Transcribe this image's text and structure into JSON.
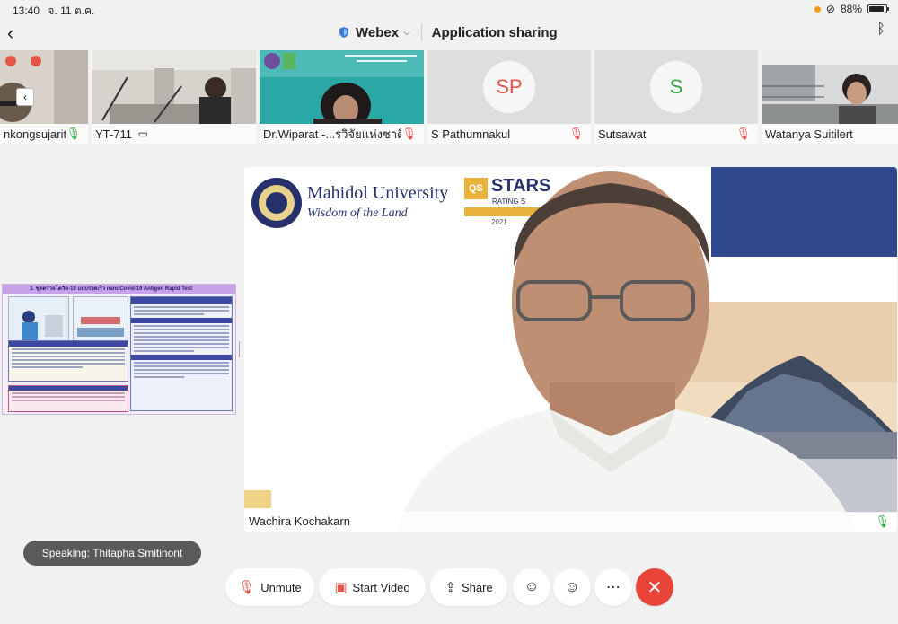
{
  "status_bar": {
    "time": "13:40",
    "date": "จ. 11 ต.ค.",
    "battery": "88%"
  },
  "header": {
    "app_name": "Webex",
    "subtitle": "Application sharing"
  },
  "thumbnails": [
    {
      "name": "nkongsujarit",
      "mic": "on"
    },
    {
      "name": "YT-711",
      "mic": "device"
    },
    {
      "name": "Dr.Wiparat -...รวิจัยแห่งชาติ",
      "mic": "muted"
    },
    {
      "name": "S Pathumnakul",
      "mic": "muted",
      "initials": "SP",
      "initials_color": "#e4564a"
    },
    {
      "name": "Sutsawat",
      "mic": "muted",
      "initials": "S",
      "initials_color": "#39a845"
    },
    {
      "name": "Watanya Suitilert",
      "mic": "none"
    }
  ],
  "slide": {
    "title": "3.  ชุดตรวจโควิด-19 แบบรวดเร็ว  nanoCovid-19 Antigen Rapid Test"
  },
  "main_video": {
    "participant": "Wachira Kochakarn",
    "banner_org": "Mahidol University",
    "banner_tagline": "Wisdom of the Land",
    "banner_badge": "STARS",
    "banner_badge_sub": "RATING S",
    "banner_year": "2021"
  },
  "speaking": {
    "text": "Speaking: Thitapha Smitinont"
  },
  "controls": {
    "unmute": "Unmute",
    "start_video": "Start Video",
    "share": "Share"
  }
}
